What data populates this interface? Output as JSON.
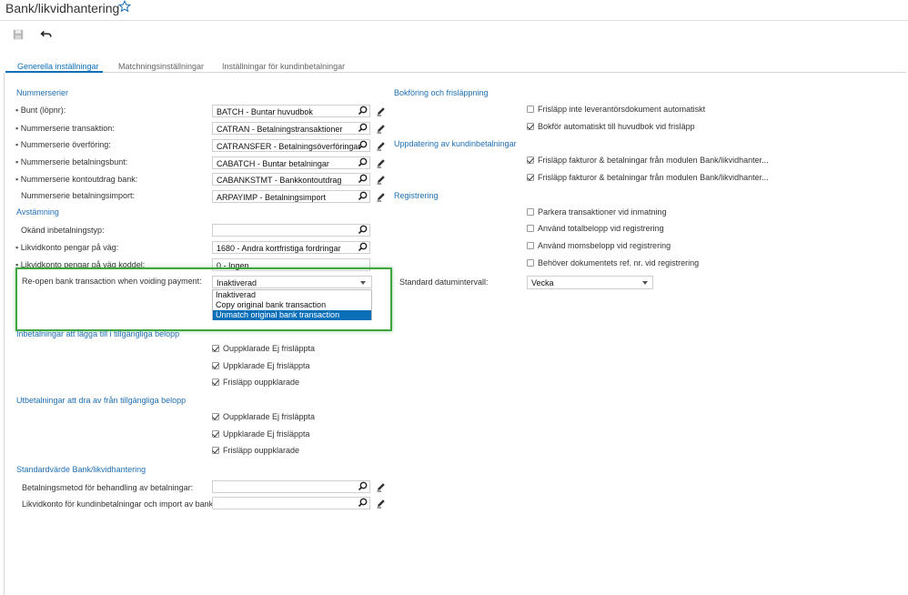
{
  "header": {
    "title": "Bank/likvidhantering"
  },
  "tabs": [
    {
      "label": "Generella inställningar"
    },
    {
      "label": "Matchningsinställningar"
    },
    {
      "label": "Inställningar för kundinbetalningar"
    }
  ],
  "left": {
    "nummerserier": {
      "title": "Nummerserier",
      "rows": [
        {
          "label": "Bunt (löpnr):",
          "value": "BATCH - Buntar huvudbok"
        },
        {
          "label": "Nummerserie transaktion:",
          "value": "CATRAN - Betalningstransaktioner"
        },
        {
          "label": "Nummerserie överföring:",
          "value": "CATRANSFER - Betalningsöverföringar"
        },
        {
          "label": "Nummerserie betalningsbunt:",
          "value": "CABATCH - Buntar betalningar"
        },
        {
          "label": "Nummerserie kontoutdrag bank:",
          "value": "CABANKSTMT - Bankkontoutdrag"
        },
        {
          "label": "Nummerserie betalningsimport:",
          "value": "ARPAYIMP - Betalningsimport"
        }
      ]
    },
    "avstamning": {
      "title": "Avstämning",
      "rows": [
        {
          "label": "Okänd inbetalningstyp:",
          "value": ""
        },
        {
          "label": "Likvidkonto pengar på väg:",
          "value": "1680 - Andra kortfristiga fordringar"
        },
        {
          "label": "Likvidkonto pengar på väg koddel:",
          "value": "0 - Ingen"
        }
      ],
      "reopen": {
        "label": "Re-open bank transaction when voiding payment:",
        "value": "Inaktiverad",
        "options": [
          "Inaktiverad",
          "Copy original bank transaction",
          "Unmatch original bank transaction"
        ]
      }
    },
    "inbetalningar": {
      "title": "Inbetalningar att lägga till i tillgängliga belopp",
      "items": [
        "Ouppklarade Ej frisläppta",
        "Uppklarade Ej frisläppta",
        "Frisläpp ouppklarade"
      ]
    },
    "utbetalningar": {
      "title": "Utbetalningar att dra av från tillgängliga belopp",
      "items": [
        "Ouppklarade Ej frisläppta",
        "Uppklarade Ej frisläppta",
        "Frisläpp ouppklarade"
      ]
    },
    "standard": {
      "title": "Standardvärde Bank/likvidhantering",
      "rows": [
        {
          "label": "Betalningsmetod för behandling av betalningar:",
          "value": ""
        },
        {
          "label": "Likvidkonto för kundinbetalningar och import av banktr...",
          "value": ""
        }
      ]
    }
  },
  "right": {
    "bokforing": {
      "title": "Bokföring och frisläppning",
      "items": [
        "Frisläpp inte leverantörsdokument automatiskt",
        "Bokför automatiskt till huvudbok vid frisläpp"
      ]
    },
    "uppdatering": {
      "title": "Uppdatering av kundinbetalningar",
      "items": [
        "Frisläpp fakturor & betalningar från modulen Bank/likvidhanter...",
        "Frisläpp fakturor & betalningar från modulen Bank/likvidhanter..."
      ]
    },
    "registrering": {
      "title": "Registrering",
      "items": [
        "Parkera transaktioner vid inmatning",
        "Använd totalbelopp vid registrering",
        "Använd momsbelopp vid registrering",
        "Behöver dokumentets ref. nr. vid registrering"
      ]
    },
    "datum": {
      "label": "Standard datumintervall:",
      "value": "Vecka"
    }
  }
}
